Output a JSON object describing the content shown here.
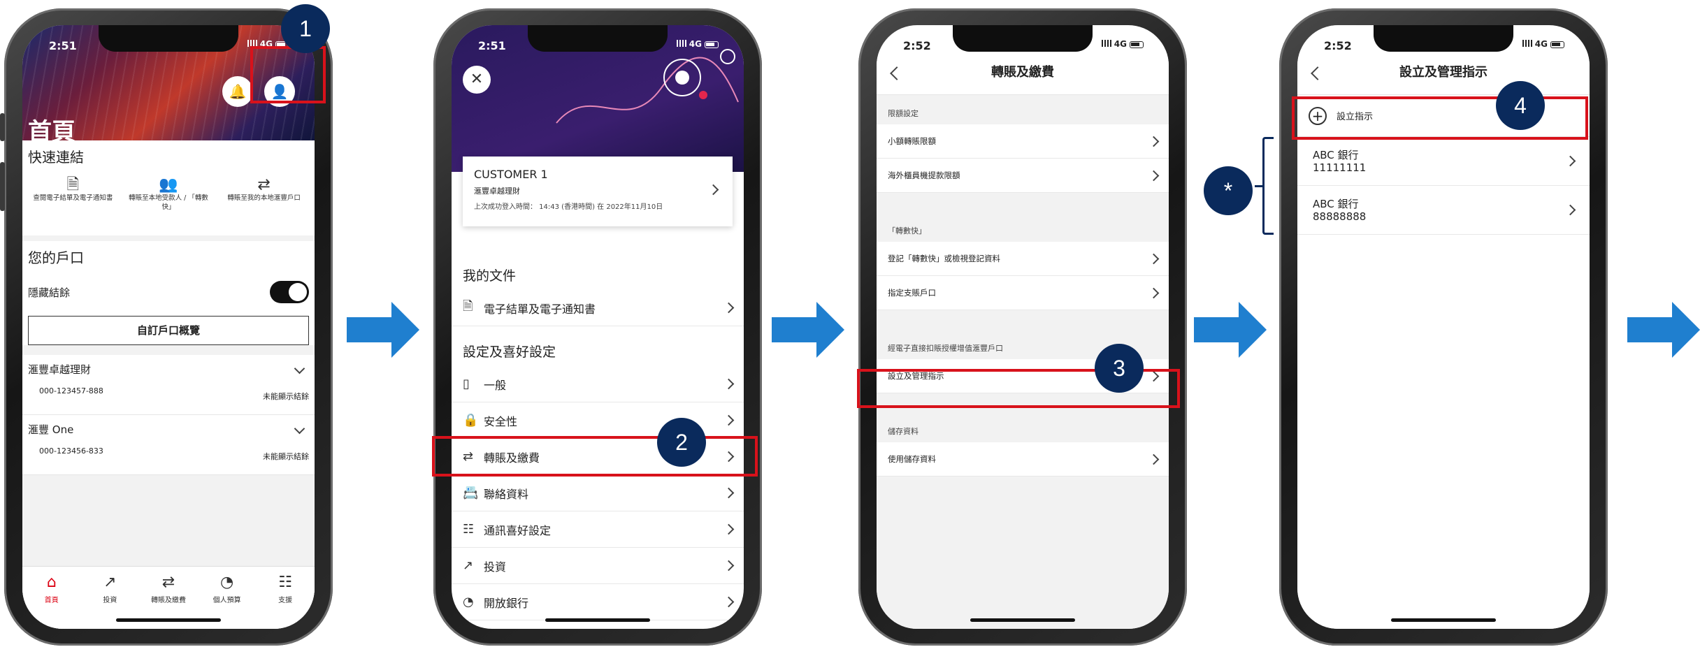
{
  "colors": {
    "hsbc_red": "#db0011",
    "badge_navy": "#0a2a5c",
    "arrow_blue": "#1f7fcf",
    "highlight_red": "#d8121b"
  },
  "steps": [
    "1",
    "2",
    "3",
    "4",
    "*"
  ],
  "screen1": {
    "time": "2:51",
    "network": "4G",
    "title": "首頁",
    "quick_links_title": "快速連結",
    "quick_links": [
      {
        "icon": "document-icon",
        "label": "查閱電子結單及電子通知書"
      },
      {
        "icon": "transfer-person-icon",
        "label": "轉賬至本地受款人 / 「轉數快」"
      },
      {
        "icon": "exchange-icon",
        "label": "轉賬至我的本地滙豐戶口"
      }
    ],
    "accounts_title": "您的戶口",
    "hide_balance": "隱藏結餘",
    "customize_btn": "自訂戶口概覽",
    "accounts": [
      {
        "name": "滙豐卓越理財",
        "number": "000-123457-888",
        "status": "未能顯示結餘"
      },
      {
        "name": "滙豐 One",
        "number": "000-123456-833",
        "status": "未能顯示結餘"
      }
    ],
    "tabs": [
      {
        "icon": "home-icon",
        "label": "首頁"
      },
      {
        "icon": "chart-icon",
        "label": "投資"
      },
      {
        "icon": "transfer-icon",
        "label": "轉賬及繳費"
      },
      {
        "icon": "budget-icon",
        "label": "個人預算"
      },
      {
        "icon": "chat-icon",
        "label": "支援"
      }
    ]
  },
  "screen2": {
    "time": "2:51",
    "network": "4G",
    "customer": "CUSTOMER 1",
    "tier": "滙豐卓越理財",
    "last_login": "上次成功登入時間： 14:43 (香港時間) 在 2022年11月10日",
    "docs_title": "我的文件",
    "docs_item": "電子結單及電子通知書",
    "settings_title": "設定及喜好設定",
    "settings_items": [
      {
        "icon": "phone-icon",
        "label": "一般"
      },
      {
        "icon": "lock-icon",
        "label": "安全性"
      },
      {
        "icon": "exchange-icon",
        "label": "轉賬及繳費"
      },
      {
        "icon": "contact-card-icon",
        "label": "聯絡資料"
      },
      {
        "icon": "message-icon",
        "label": "通訊喜好設定"
      },
      {
        "icon": "chart-icon",
        "label": "投資"
      },
      {
        "icon": "open-banking-icon",
        "label": "開放銀行"
      }
    ]
  },
  "screen3": {
    "time": "2:52",
    "network": "4G",
    "title": "轉賬及繳費",
    "groups": [
      {
        "header": "限額設定",
        "items": [
          "小額轉賬限額",
          "海外櫃員機提款限額"
        ]
      },
      {
        "header": "「轉數快」",
        "items": [
          "登記「轉數快」或檢視登記資料",
          "指定支賬戶口"
        ]
      },
      {
        "header": "經電子直接扣賬授權增值滙豐戶口",
        "items": [
          "設立及管理指示"
        ]
      },
      {
        "header": "儲存資料",
        "items": [
          "使用儲存資料"
        ]
      }
    ]
  },
  "screen4": {
    "time": "2:52",
    "network": "4G",
    "title": "設立及管理指示",
    "add_label": "設立指示",
    "instructions": [
      {
        "bank": "ABC 銀行",
        "account": "11111111"
      },
      {
        "bank": "ABC 銀行",
        "account": "88888888"
      }
    ]
  }
}
